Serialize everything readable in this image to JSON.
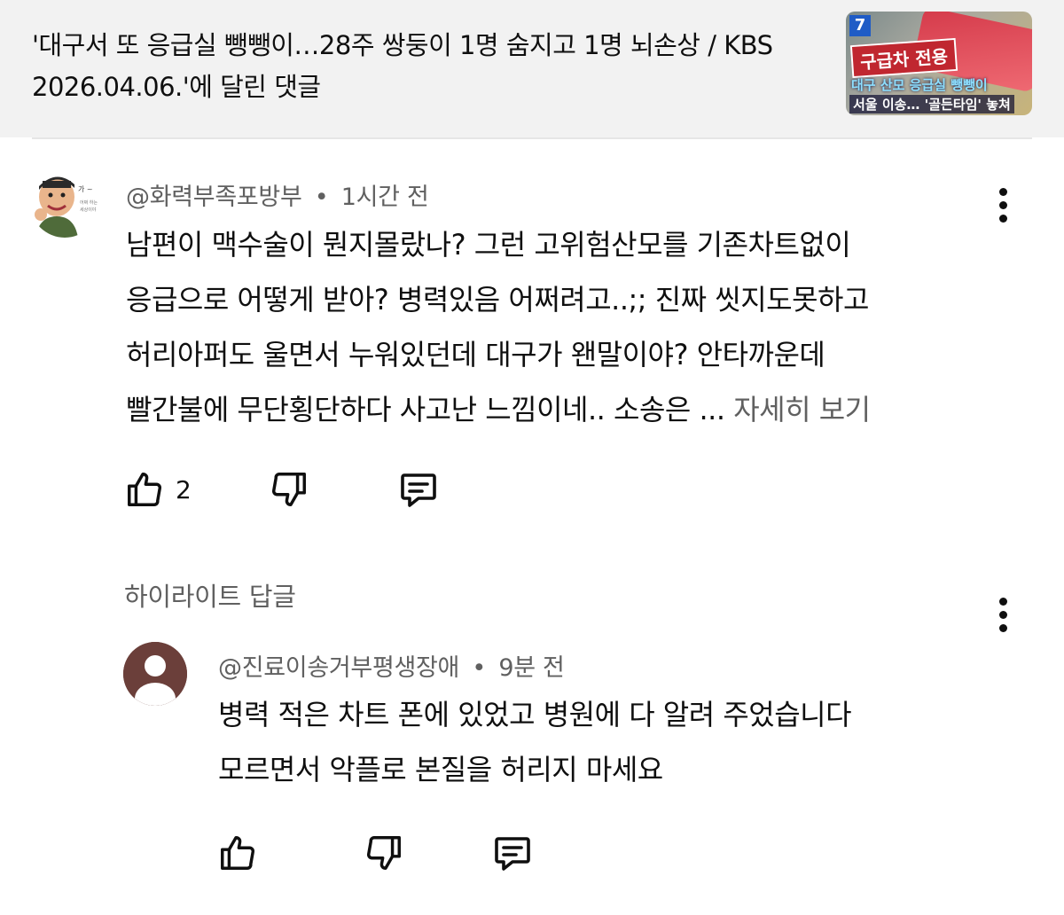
{
  "header": {
    "title": "'대구서 또 응급실 뺑뺑이…28주 쌍둥이 1명 숨지고 1명 뇌손상 / KBS 2026.04.06.'에 달린 댓글",
    "thumbnail": {
      "channel_badge": "7",
      "sign_text": "구급차 전용",
      "caption_line1": "대구 산모 응급실 뺑뺑이",
      "caption_line2": "서울 이송… '골든타임' 놓쳐"
    }
  },
  "comment": {
    "author": "@화력부족포방부",
    "time": "1시간 전",
    "separator": "•",
    "lines": [
      "남편이 맥수술이 뭔지몰랐나? 그런 고위험산모를 기존차트없이",
      "응급으로 어떻게 받아? 병력있음 어쩌려고..;; 진짜 씻지도못하고",
      "허리아퍼도 울면서 누워있던데 대구가 왠말이야? 안타까운데",
      "빨간불에 무단횡단하다 사고난 느낌이네.. 소송은 ..."
    ],
    "more_label": "자세히 보기",
    "like_count": "2"
  },
  "highlight_label": "하이라이트 답글",
  "reply": {
    "author": "@진료이송거부평생장애",
    "time": "9분 전",
    "separator": "•",
    "lines": [
      "병력 적은 차트 폰에 있었고 병원에 다 알려  주었습니다",
      "모르면서 악플로 본질을 허리지 마세요"
    ]
  },
  "colors": {
    "header_bg": "#f2f2f2",
    "text": "#0f0f0f",
    "secondary": "#606060",
    "reply_avatar": "#6b3f3a"
  },
  "icons": [
    "like-icon",
    "dislike-icon",
    "reply-icon",
    "more-vert-icon"
  ]
}
